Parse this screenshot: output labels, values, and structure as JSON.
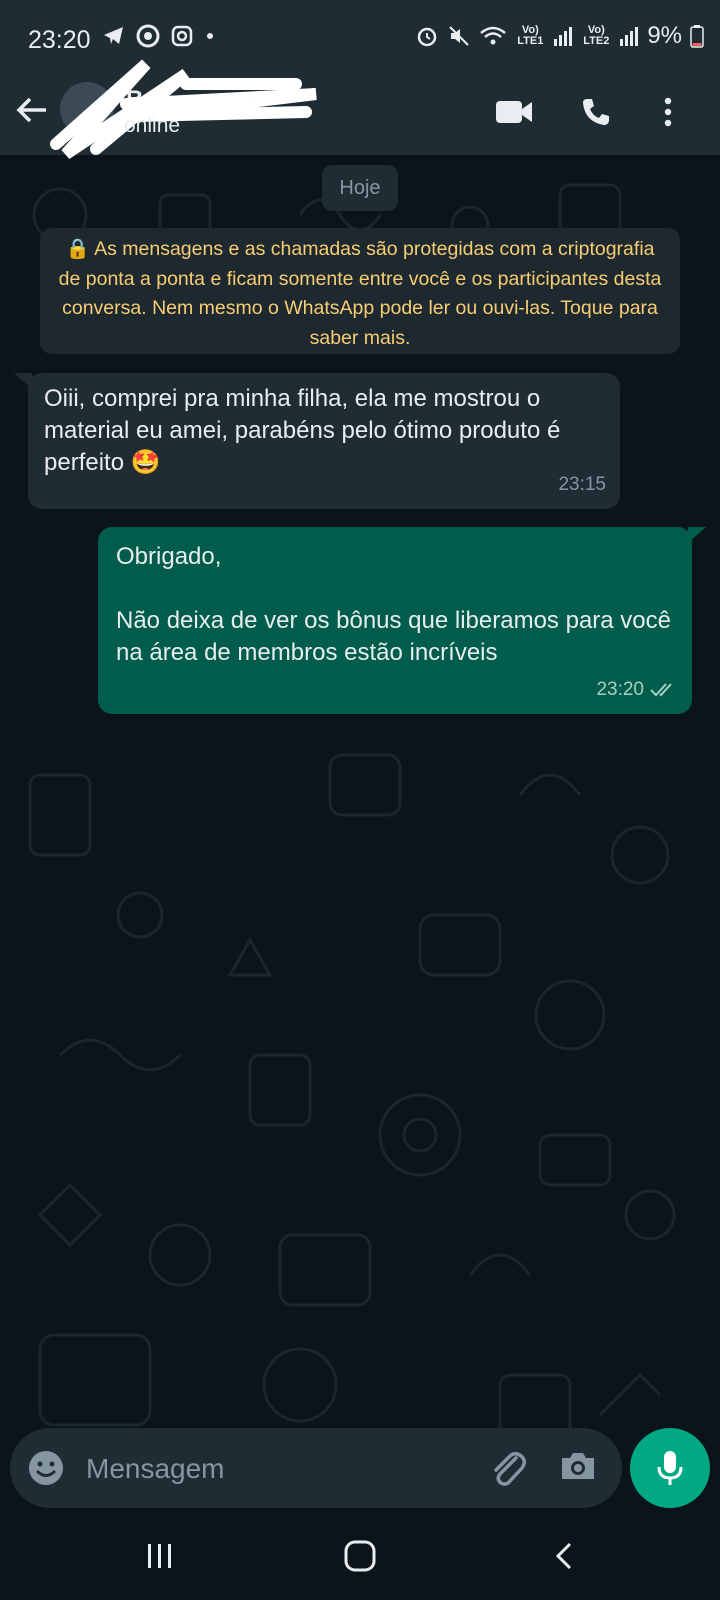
{
  "status_bar": {
    "time": "23:20",
    "battery": "9%",
    "sim1": "Vo) LTE1",
    "sim2": "Vo) LTE2",
    "left_icons": [
      "telegram-icon",
      "chrome-icon",
      "instagram-icon",
      "dot-icon"
    ],
    "right_icons": [
      "alarm-icon",
      "mute-icon",
      "wifi-icon",
      "signal-icon",
      "signal-icon",
      "battery-icon"
    ]
  },
  "header": {
    "contact_name": "B",
    "contact_status": "online",
    "icons": [
      "back-arrow-icon",
      "video-call-icon",
      "voice-call-icon",
      "more-options-icon"
    ]
  },
  "chat": {
    "date_chip": "Hoje",
    "encryption_notice": "🔒 As mensagens e as chamadas são protegidas com a criptografia de ponta a ponta e ficam somente entre você e os participantes desta conversa. Nem mesmo o WhatsApp pode ler ou ouvi-las. Toque para saber mais.",
    "messages": [
      {
        "direction": "incoming",
        "text": "Oiii, comprei pra minha filha, ela me mostrou o material eu amei, parabéns pelo ótimo produto é perfeito 🤩",
        "time": "23:15"
      },
      {
        "direction": "outgoing",
        "text": "Obrigado,\n\nNão deixa de ver os bônus que liberamos para você na área de membros estão incríveis",
        "time": "23:20",
        "status": "read"
      }
    ]
  },
  "composer": {
    "placeholder": "Mensagem",
    "icons": [
      "emoji-icon",
      "attach-icon",
      "camera-icon",
      "mic-icon"
    ]
  },
  "colors": {
    "background": "#0b141a",
    "header": "#1f2c34",
    "incoming_bubble": "#1f2c34",
    "outgoing_bubble": "#005c4b",
    "notice_text": "#f7cd73",
    "accent": "#00a884"
  }
}
